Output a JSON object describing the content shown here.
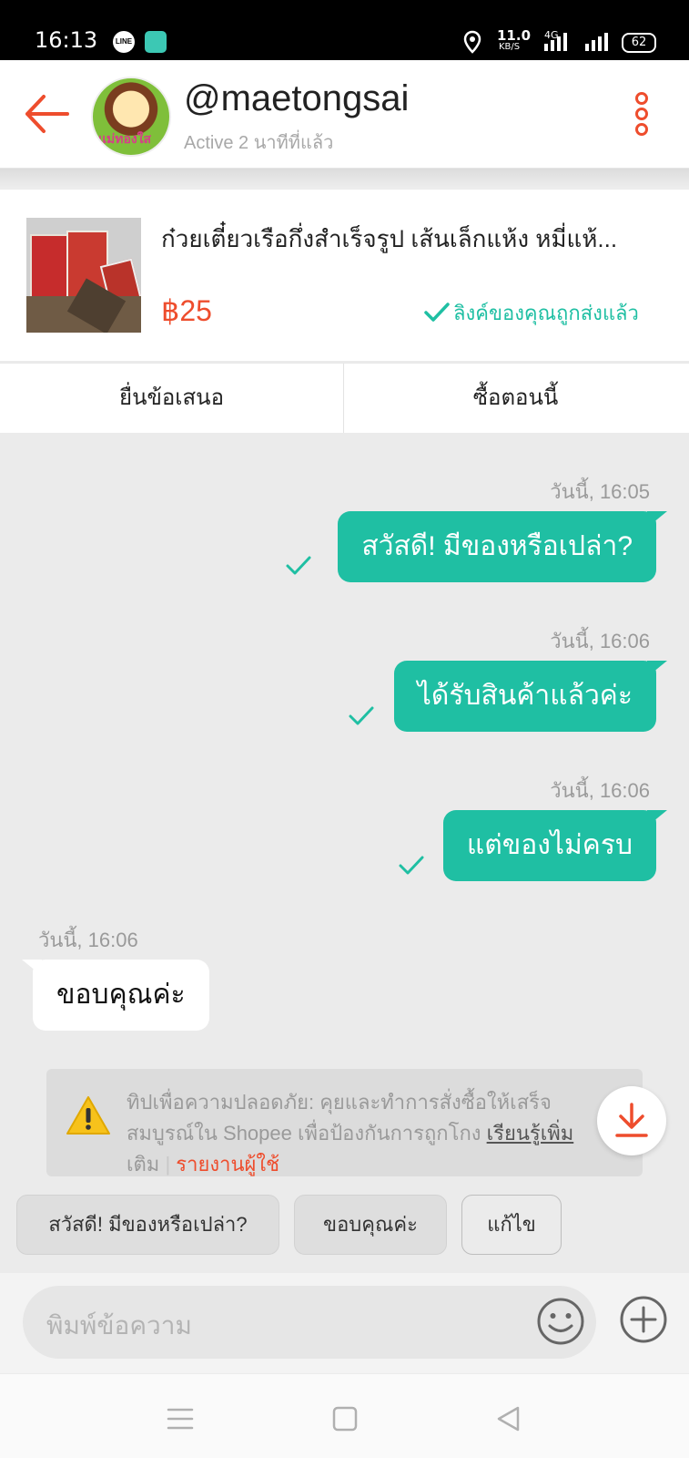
{
  "status_bar": {
    "time": "16:13",
    "line_label": "LINE",
    "speed": "11.0",
    "speed_unit": "KB/S",
    "network": "4G",
    "battery": "62"
  },
  "header": {
    "username": "@maetongsai",
    "active_status": "Active 2 นาทีที่แล้ว",
    "avatar_text": "แม่ทองใส"
  },
  "product": {
    "title": "ก๋วยเตี๋ยวเรือกึ่งสำเร็จรูป เส้นเล็กแห้ง หมี่แห้...",
    "price": "฿25",
    "link_sent": "ลิงค์ของคุณถูกส่งแล้ว"
  },
  "actions": {
    "offer": "ยื่นข้อเสนอ",
    "buy_now": "ซื้อตอนนี้"
  },
  "messages": [
    {
      "time": "วันนี้, 16:05",
      "text": "สวัสดี! มีของหรือเปล่า?",
      "direction": "out"
    },
    {
      "time": "วันนี้, 16:06",
      "text": "ได้รับสินค้าแล้วค่ะ",
      "direction": "out"
    },
    {
      "time": "วันนี้, 16:06",
      "text": "แต่ของไม่ครบ",
      "direction": "out"
    },
    {
      "time": "วันนี้, 16:06",
      "text": "ขอบคุณค่ะ",
      "direction": "in"
    }
  ],
  "tip": {
    "line1": "ทิปเพื่อความปลอดภัย: คุยและทำการสั่งซื้อให้เสร็จ",
    "line2": "สมบูรณ์ใน Shopee เพื่อป้องกันการถูกโกง ",
    "learn_more": "เรียนรู้เพิ่ม",
    "line3": "เติม",
    "separator": "|",
    "report": "รายงานผู้ใช้"
  },
  "quick_replies": [
    "สวัสดี! มีของหรือเปล่า?",
    "ขอบคุณค่ะ",
    "แก้ไข"
  ],
  "input": {
    "placeholder": "พิมพ์ข้อความ"
  },
  "colors": {
    "brand": "#ee4d2d",
    "bubble": "#1fbfa3",
    "bg": "#ebebeb"
  }
}
